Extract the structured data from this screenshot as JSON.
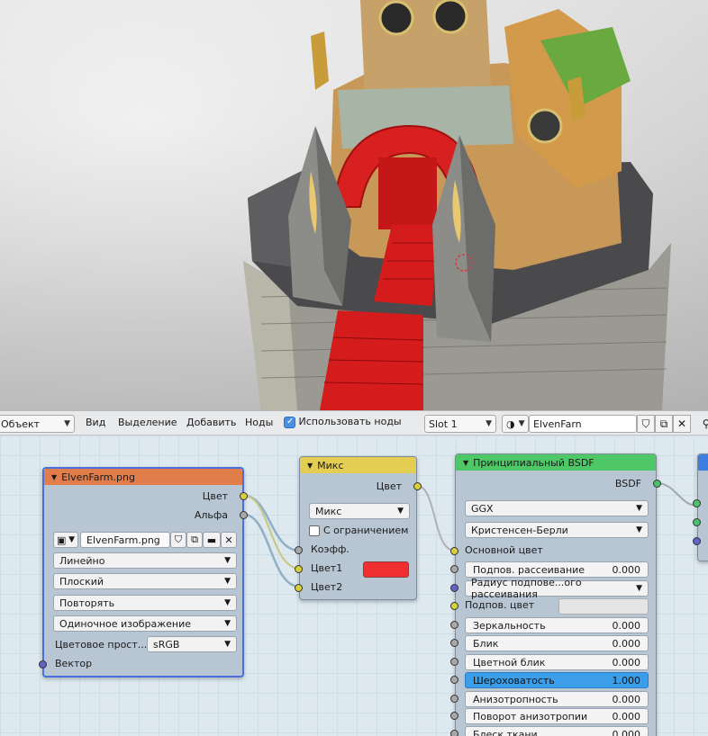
{
  "header": {
    "object_mode": "Объект",
    "menu": [
      "Вид",
      "Выделение",
      "Добавить",
      "Ноды"
    ],
    "use_nodes_label": "Использовать ноды",
    "slot": "Slot 1",
    "material_name": "ElvenFarn"
  },
  "image_node": {
    "title": "ElvenFarm.png",
    "out_color": "Цвет",
    "out_alpha": "Альфа",
    "image_name": "ElvenFarm.png",
    "interpolation": "Линейно",
    "projection": "Плоский",
    "extension": "Повторять",
    "source": "Одиночное изображение",
    "colorspace_label": "Цветовое прост...",
    "colorspace": "sRGB",
    "in_vector": "Вектор"
  },
  "mix_node": {
    "title": "Микс",
    "out_color": "Цвет",
    "blend": "Микс",
    "clamp_label": "С ограничением",
    "in_fac": "Коэфф.",
    "in_color1": "Цвет1",
    "in_color2": "Цвет2",
    "color1_value": "#f03030"
  },
  "bsdf_node": {
    "title": "Принципиальный BSDF",
    "out_bsdf": "BSDF",
    "distribution": "GGX",
    "subsurface_method": "Кристенсен-Берли",
    "base_color": "Основной цвет",
    "subsurface": {
      "label": "Подпов. рассеивание",
      "value": "0.000"
    },
    "subsurface_radius": "Радиус подпове...ого рассеивания",
    "subsurface_color": "Подпов. цвет",
    "metallic": {
      "label": "Зеркальность",
      "value": "0.000"
    },
    "specular": {
      "label": "Блик",
      "value": "0.000"
    },
    "specular_tint": {
      "label": "Цветной блик",
      "value": "0.000"
    },
    "roughness": {
      "label": "Шероховатость",
      "value": "1.000"
    },
    "anisotropic": {
      "label": "Анизотропность",
      "value": "0.000"
    },
    "anisotropic_rotation": {
      "label": "Поворот анизотропии",
      "value": "0.000"
    },
    "sheen": {
      "label": "Блеск ткани",
      "value": "0.000"
    }
  },
  "colors": {
    "image_header": "#e07d4a",
    "mix_header": "#e3cd52",
    "bsdf_header": "#4ec867",
    "output_header": "#3e7ee0",
    "active_field": "#3c9de8"
  }
}
